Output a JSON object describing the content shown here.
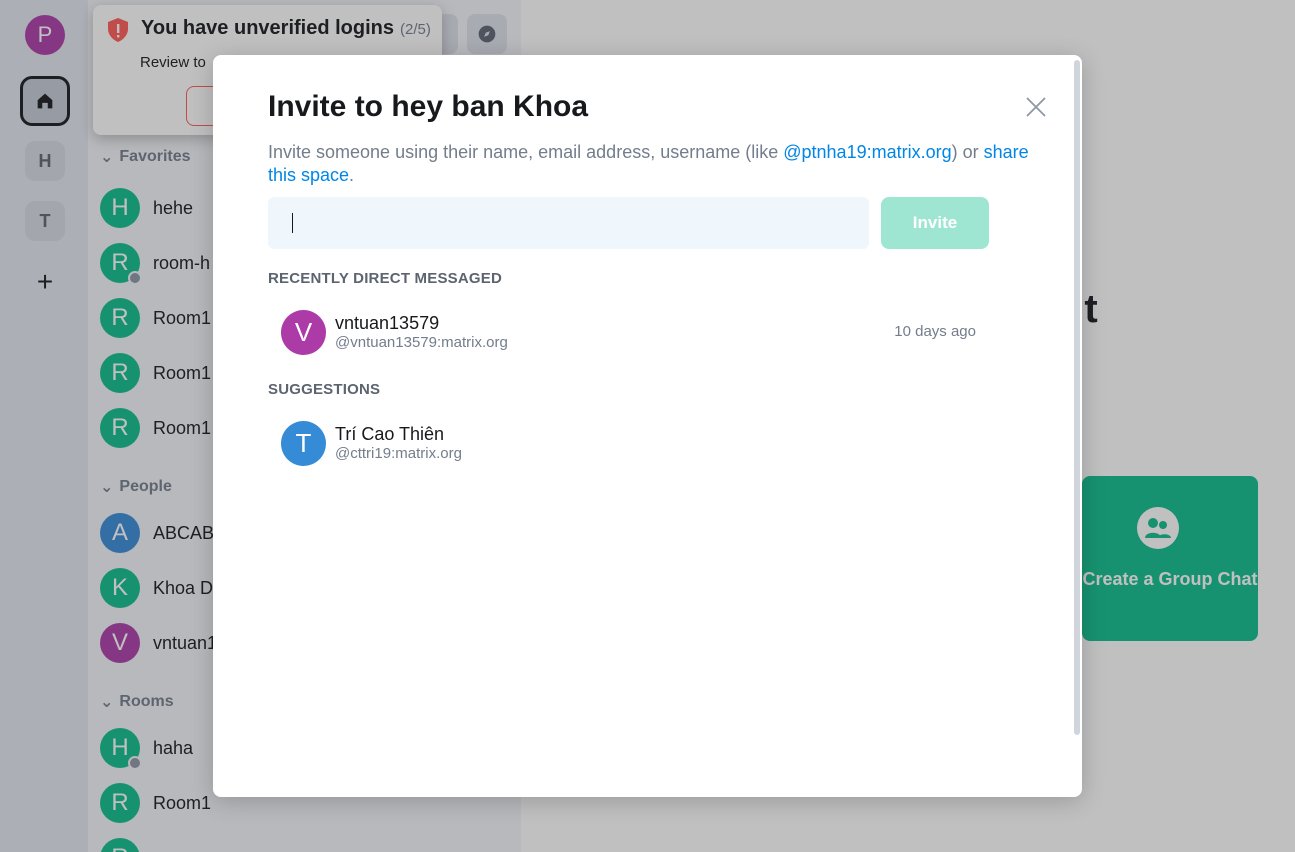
{
  "spaces": {
    "user_initial": "P",
    "items": [
      {
        "letter": "H"
      },
      {
        "letter": "T"
      }
    ],
    "add_label": "+"
  },
  "toast": {
    "title": "You have unverified logins",
    "count": "(2/5)",
    "body": "Review to"
  },
  "roomlist": {
    "favorites_label": "Favorites",
    "favorites": [
      {
        "initial": "H",
        "name": "hehe"
      },
      {
        "initial": "R",
        "name": "room-h"
      },
      {
        "initial": "R",
        "name": "Room1"
      },
      {
        "initial": "R",
        "name": "Room1"
      },
      {
        "initial": "R",
        "name": "Room1"
      }
    ],
    "people_label": "People",
    "people": [
      {
        "initial": "A",
        "name": "ABCAB"
      },
      {
        "initial": "K",
        "name": "Khoa D"
      },
      {
        "initial": "V",
        "name": "vntuan1"
      }
    ],
    "rooms_label": "Rooms",
    "rooms": [
      {
        "initial": "H",
        "name": "haha"
      },
      {
        "initial": "R",
        "name": "Room1"
      },
      {
        "initial": "R",
        "name": ""
      }
    ]
  },
  "main": {
    "heading_fragment": "nt",
    "group_card_label": "Create a Group Chat"
  },
  "dialog": {
    "title": "Invite to hey ban Khoa",
    "desc_prefix": "Invite someone using their name, email address, username (like ",
    "desc_user_link": "@ptnha19:matrix.org",
    "desc_mid": ") or ",
    "desc_share_link": "share this space",
    "desc_suffix": ".",
    "input_value": "",
    "invite_label": "Invite",
    "recent_label": "RECENTLY DIRECT MESSAGED",
    "recent": [
      {
        "initial": "V",
        "name": "vntuan13579",
        "id": "@vntuan13579:matrix.org",
        "time": "10 days ago"
      }
    ],
    "suggestions_label": "SUGGESTIONS",
    "suggestions": [
      {
        "initial": "T",
        "name": "Trí Cao Thiên",
        "id": "@cttri19:matrix.org"
      }
    ]
  },
  "colors": {
    "accent": "#0dbd8b",
    "link": "#0086e6",
    "avatar_purple": "#ac3ba8",
    "avatar_green": "#0dbd8b",
    "avatar_blue": "#368bd6",
    "warning_red": "#ff5b55"
  }
}
